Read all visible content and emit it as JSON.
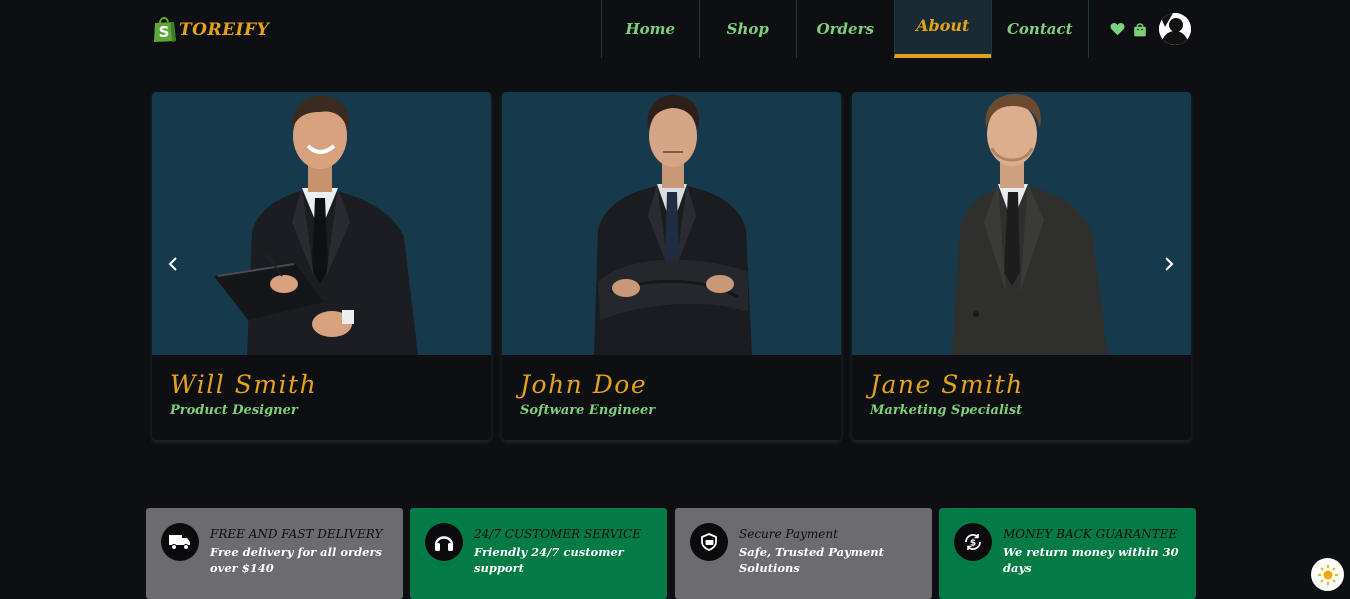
{
  "brand": {
    "name": "TOREIFY",
    "logo_letter": "S"
  },
  "nav": {
    "items": [
      {
        "label": "Home"
      },
      {
        "label": "Shop"
      },
      {
        "label": "Orders"
      },
      {
        "label": "About"
      },
      {
        "label": "Contact"
      }
    ],
    "active": "About"
  },
  "header_icons": [
    "heart-icon",
    "shopping-bag-icon",
    "user-avatar"
  ],
  "team": [
    {
      "name": "Will Smith",
      "role": "Product Designer"
    },
    {
      "name": "John Doe",
      "role": "Software Engineer"
    },
    {
      "name": "Jane Smith",
      "role": "Marketing Specialist"
    }
  ],
  "features": [
    {
      "icon": "truck-icon",
      "title": "FREE AND FAST DELIVERY",
      "desc": "Free delivery for all orders over $140",
      "color": "#6c6c70"
    },
    {
      "icon": "headphones-icon",
      "title": "24/7 CUSTOMER SERVICE",
      "desc": "Friendly 24/7 customer support",
      "color": "#047a47"
    },
    {
      "icon": "secure-payment-icon",
      "title": "Secure Payment",
      "desc": "Safe, Trusted Payment Solutions",
      "color": "#6c6c70"
    },
    {
      "icon": "money-back-icon",
      "title": "MONEY BACK GUARANTEE",
      "desc": "We return money within 30 days",
      "color": "#047a47"
    }
  ],
  "colors": {
    "background": "#0e0f13",
    "accent": "#e3a21a",
    "green_text": "#7fd07b",
    "card_bg": "#163a4b"
  }
}
